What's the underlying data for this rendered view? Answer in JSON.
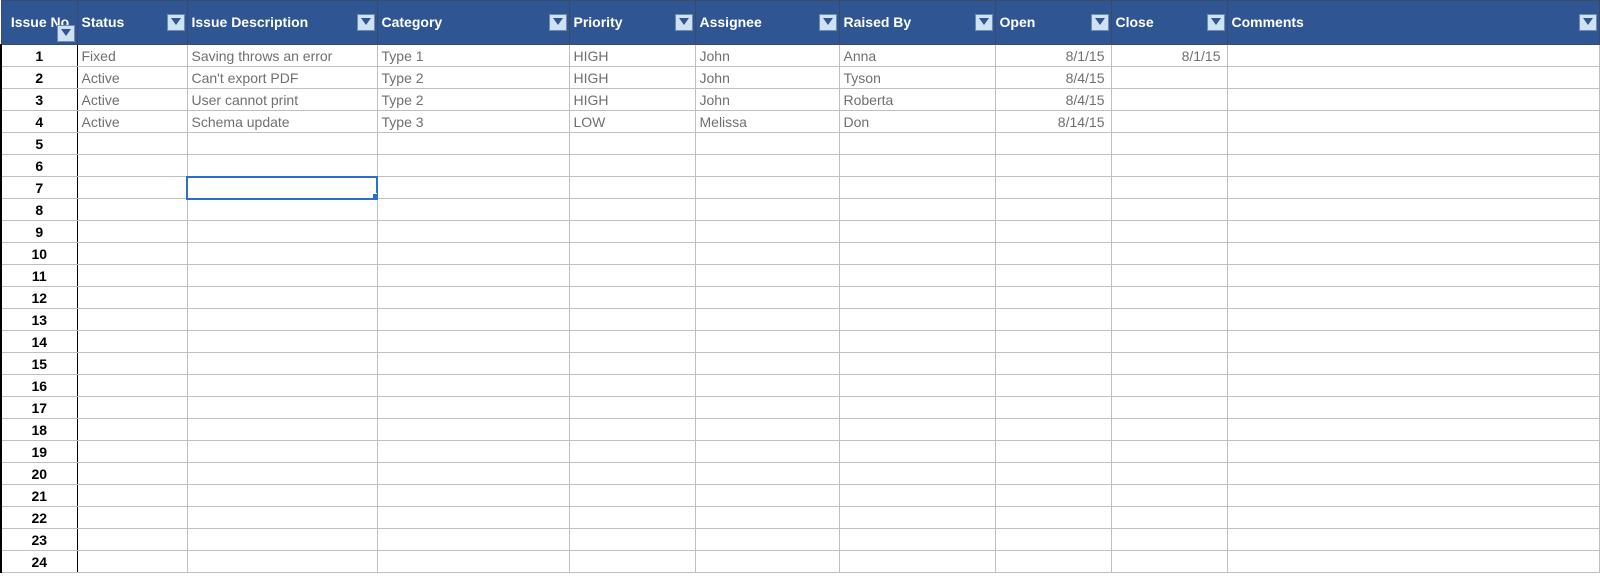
{
  "columns": [
    {
      "key": "issue_no",
      "label": "Issue No",
      "class": "col-issue-no"
    },
    {
      "key": "status",
      "label": "Status",
      "class": "col-status"
    },
    {
      "key": "desc",
      "label": "Issue Description",
      "class": "col-desc"
    },
    {
      "key": "category",
      "label": "Category",
      "class": "col-category"
    },
    {
      "key": "priority",
      "label": "Priority",
      "class": "col-priority"
    },
    {
      "key": "assignee",
      "label": "Assignee",
      "class": "col-assignee"
    },
    {
      "key": "raised",
      "label": "Raised By",
      "class": "col-raised"
    },
    {
      "key": "open",
      "label": "Open",
      "class": "col-open",
      "align": "right"
    },
    {
      "key": "close",
      "label": "Close",
      "class": "col-close",
      "align": "right"
    },
    {
      "key": "comments",
      "label": "Comments",
      "class": "col-comments"
    }
  ],
  "rows": [
    {
      "issue_no": "1",
      "status": "Fixed",
      "desc": "Saving throws an error",
      "category": "Type 1",
      "priority": "HIGH",
      "assignee": "John",
      "raised": "Anna",
      "open": "8/1/15",
      "close": "8/1/15",
      "comments": ""
    },
    {
      "issue_no": "2",
      "status": "Active",
      "desc": "Can't export PDF",
      "category": "Type 2",
      "priority": "HIGH",
      "assignee": "John",
      "raised": "Tyson",
      "open": "8/4/15",
      "close": "",
      "comments": ""
    },
    {
      "issue_no": "3",
      "status": "Active",
      "desc": "User cannot print",
      "category": "Type 2",
      "priority": "HIGH",
      "assignee": "John",
      "raised": "Roberta",
      "open": "8/4/15",
      "close": "",
      "comments": ""
    },
    {
      "issue_no": "4",
      "status": "Active",
      "desc": "Schema update",
      "category": "Type 3",
      "priority": "LOW",
      "assignee": "Melissa",
      "raised": "Don",
      "open": "8/14/15",
      "close": "",
      "comments": ""
    },
    {
      "issue_no": "5"
    },
    {
      "issue_no": "6"
    },
    {
      "issue_no": "7"
    },
    {
      "issue_no": "8"
    },
    {
      "issue_no": "9"
    },
    {
      "issue_no": "10"
    },
    {
      "issue_no": "11"
    },
    {
      "issue_no": "12"
    },
    {
      "issue_no": "13"
    },
    {
      "issue_no": "14"
    },
    {
      "issue_no": "15"
    },
    {
      "issue_no": "16"
    },
    {
      "issue_no": "17"
    },
    {
      "issue_no": "18"
    },
    {
      "issue_no": "19"
    },
    {
      "issue_no": "20"
    },
    {
      "issue_no": "21"
    },
    {
      "issue_no": "22"
    },
    {
      "issue_no": "23"
    },
    {
      "issue_no": "24"
    }
  ],
  "selected_cell": {
    "row": 6,
    "col": "desc"
  }
}
